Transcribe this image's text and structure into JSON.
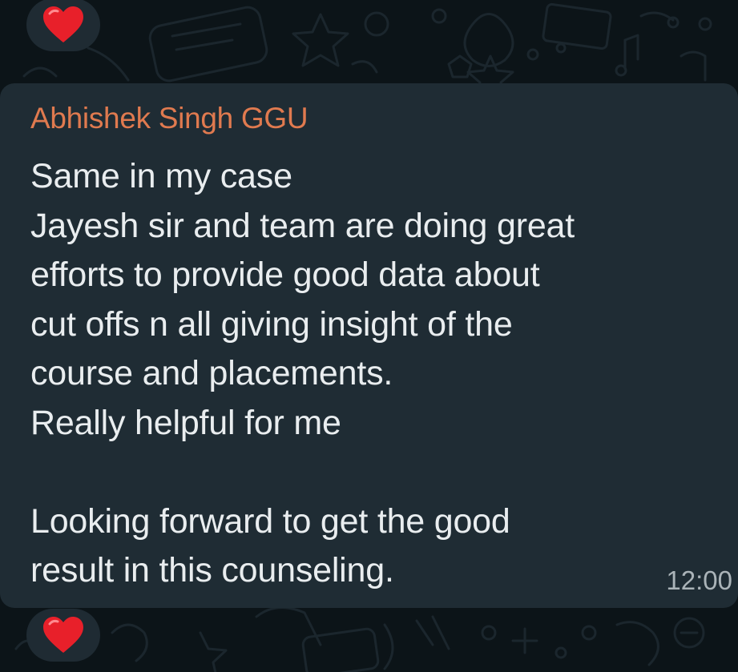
{
  "chat": {
    "message": {
      "sender": "Abhishek Singh GGU",
      "lines": [
        "Same in my case",
        "Jayesh sir and team are doing great",
        "efforts to provide good data about",
        "cut offs n all giving insight of the",
        "course and placements.",
        "Really helpful for me",
        "",
        "Looking forward to get the good",
        "result in this counseling."
      ],
      "time": "12:00"
    },
    "reactions": {
      "top_emoji": "red-heart",
      "bottom_emoji": "red-heart"
    },
    "colors": {
      "background": "#0c1418",
      "bubble": "#1f2c34",
      "sender_name": "#e07a4f",
      "message_text": "#e9edef",
      "timestamp": "#aab3b8",
      "heart": "#e8202a"
    }
  }
}
